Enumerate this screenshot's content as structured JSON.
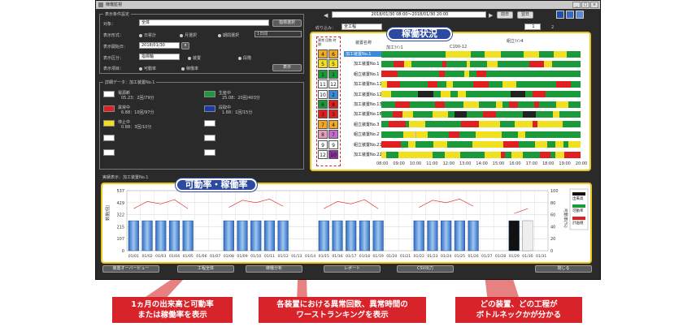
{
  "window": {
    "title": "稼働監視"
  },
  "conditions": {
    "title": "表示条件設定",
    "line_label": "对象：",
    "line_value": "全体",
    "select_button": "指標選択",
    "format_label": "表示形式：",
    "format_opts": [
      "日累計",
      "月選択",
      "期間選択"
    ],
    "format_dropdown": "1日間",
    "start_label": "表示開始日：",
    "start_value": "2018/01/30",
    "unit_label": "表示区分：",
    "unit_dropdown": "指標軸",
    "unit_opts": [
      "装置",
      "段階"
    ],
    "items_label": "表示項目：",
    "items_opts": [
      "可動率",
      "稼働率"
    ],
    "show_button": "表示"
  },
  "detail": {
    "title": "詳細データ：加工装置No.1",
    "items": [
      {
        "color": "#ffffff",
        "label": "電源断",
        "value": "05.23：2回/79分"
      },
      {
        "color": "#1a9a3a",
        "label": "生産中",
        "value": "25.08：20回/403分"
      },
      {
        "color": "#e02020",
        "label": "異常中",
        "value": "6.88：10回/97分"
      },
      {
        "color": "#1a3aa8",
        "label": "段取中",
        "value": "1.88：1回/15分"
      },
      {
        "color": "#f0e020",
        "label": "停止中",
        "value": "0.88：3回/10分"
      },
      {
        "color": "#ffffff",
        "label": "",
        "value": ""
      },
      {
        "color": "#ffffff",
        "label": "",
        "value": ""
      },
      {
        "color": "#ffffff",
        "label": "",
        "value": ""
      },
      {
        "color": "#ffffff",
        "label": "",
        "value": ""
      },
      {
        "color": "#ffffff",
        "label": "",
        "value": ""
      }
    ]
  },
  "timeline": {
    "range": "2018/01/30 08:00～2018/01/30 20:00",
    "btn_prev": "前日",
    "btn_next": "翌日",
    "group_label": "絞り込み：",
    "group_value": "全工程",
    "page_value": "1",
    "page_total": "2",
    "col_rank": "異常 回数 時間",
    "col_name": "装置名称",
    "group_names": [
      "加工ﾗｲﾝ1",
      "C100-12",
      "組立ﾗｲﾝ4"
    ],
    "rows": [
      {
        "c1": "4",
        "c2": "6",
        "c1c": "#f5a623",
        "c2c": "#f5a623",
        "name": "加工装置No.1",
        "sel": true
      },
      {
        "c1": "5",
        "c2": "5",
        "c1c": "#f0e020",
        "c2c": "#f0e020",
        "name": "加工装置No.1"
      },
      {
        "c1": "1",
        "c2": "1",
        "c1c": "#1a9a3a",
        "c2c": "#1a9a3a",
        "name": "組立装置No.1"
      },
      {
        "c1": "11",
        "c2": "12",
        "c1c": "#ffffff",
        "c2c": "#ffffff",
        "name": "加工装置No.11"
      },
      {
        "c1": "10",
        "c2": "2",
        "c1c": "#ffffff",
        "c2c": "#3b8ad9",
        "name": "加工装置No.12"
      },
      {
        "c1": "6",
        "c2": "8",
        "c1c": "#1a9a3a",
        "c2c": "#e02020",
        "name": "加工装置No.13"
      },
      {
        "c1": "3",
        "c2": "3",
        "c1c": "#e02020",
        "c2c": "#e02020",
        "name": "加工装置No.18"
      },
      {
        "c1": "7",
        "c2": "4",
        "c1c": "#f5a623",
        "c2c": "#f5a623",
        "name": "組立装置No.3"
      },
      {
        "c1": "8",
        "c2": "7",
        "c1c": "#e89fbf",
        "c2c": "#c36bd0",
        "name": "組立装置No.2"
      },
      {
        "c1": "9",
        "c2": "9",
        "c1c": "#ffffff",
        "c2c": "#ffffff",
        "name": "組立装置No.21"
      },
      {
        "c1": "12",
        "c2": "10",
        "c1c": "#ffffff",
        "c2c": "#8b2fa0",
        "name": "加工装置No.22"
      }
    ],
    "hours": [
      "08:00",
      "09:00",
      "10:00",
      "11:00",
      "12:00",
      "13:00",
      "14:00",
      "15:00",
      "16:00",
      "17:00",
      "18:00",
      "19:00",
      "20:00"
    ]
  },
  "bottom": {
    "title": "実績表示：加工装置No.1",
    "y_left": [
      "537",
      "429",
      "322",
      "215",
      "107",
      "0"
    ],
    "y_right": [
      "100",
      "80",
      "60",
      "40",
      "20",
      "0"
    ],
    "y_left_title": "数量[個]",
    "y_right_title": "可動率(%)",
    "legend": [
      "出来高",
      "可動率",
      "計画値"
    ],
    "dates": [
      "01/01",
      "01/02",
      "01/03",
      "01/04",
      "01/05",
      "01/06",
      "01/07",
      "01/08",
      "01/09",
      "01/10",
      "01/11",
      "01/12",
      "01/13",
      "01/14",
      "01/15",
      "01/16",
      "01/17",
      "01/18",
      "01/19",
      "01/20",
      "01/21",
      "01/22",
      "01/23",
      "01/24",
      "01/25",
      "01/26",
      "01/27",
      "01/28",
      "01/29",
      "01/30",
      "01/31"
    ],
    "buttons": [
      "装置オーバービュー",
      "工程全体",
      "稼働分析",
      "レポート",
      "CSV出力",
      "閉じる"
    ]
  },
  "chart_data": {
    "type": "bar",
    "categories": [
      "01/01",
      "01/02",
      "01/03",
      "01/04",
      "01/05",
      "01/06",
      "01/07",
      "01/08",
      "01/09",
      "01/10",
      "01/11",
      "01/12",
      "01/13",
      "01/14",
      "01/15",
      "01/16",
      "01/17",
      "01/18",
      "01/19",
      "01/20",
      "01/21",
      "01/22",
      "01/23",
      "01/24",
      "01/25",
      "01/26",
      "01/27",
      "01/28",
      "01/29",
      "01/30",
      "01/31"
    ],
    "series": [
      {
        "name": "出来高",
        "values": [
          268,
          268,
          268,
          268,
          268,
          0,
          0,
          268,
          268,
          268,
          268,
          268,
          0,
          0,
          268,
          268,
          268,
          268,
          268,
          0,
          0,
          268,
          268,
          268,
          268,
          268,
          0,
          0,
          268,
          268,
          0
        ]
      },
      {
        "name": "可動率",
        "values": [
          70,
          82,
          78,
          85,
          70,
          0,
          0,
          72,
          84,
          80,
          86,
          74,
          0,
          0,
          70,
          82,
          78,
          85,
          70,
          0,
          0,
          72,
          84,
          80,
          86,
          74,
          0,
          0,
          62,
          70,
          0
        ]
      }
    ],
    "ylim": [
      0,
      537
    ],
    "y2lim": [
      0,
      100
    ]
  },
  "callouts": {
    "left": "1ヵ月の出来高と可動率\nまたは稼働率を表示",
    "mid": "各装置における異常回数、異常時間の\nワーストランキングを表示",
    "right": "どの装置、どの工程が\nボトルネックかが分かる",
    "pill_top": "稼働状況",
    "pill_bottom": "可動率・稼働率"
  }
}
